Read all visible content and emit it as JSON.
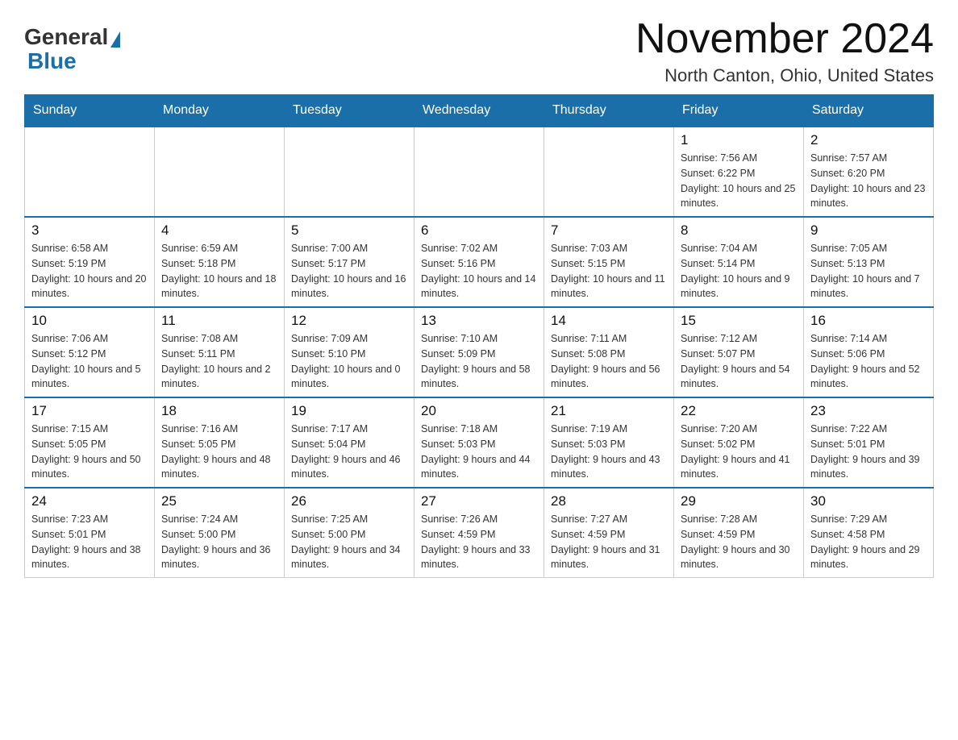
{
  "header": {
    "logo": {
      "general": "General",
      "blue": "Blue"
    },
    "title": "November 2024",
    "location": "North Canton, Ohio, United States"
  },
  "calendar": {
    "days_of_week": [
      "Sunday",
      "Monday",
      "Tuesday",
      "Wednesday",
      "Thursday",
      "Friday",
      "Saturday"
    ],
    "weeks": [
      [
        {
          "day": "",
          "sunrise": "",
          "sunset": "",
          "daylight": ""
        },
        {
          "day": "",
          "sunrise": "",
          "sunset": "",
          "daylight": ""
        },
        {
          "day": "",
          "sunrise": "",
          "sunset": "",
          "daylight": ""
        },
        {
          "day": "",
          "sunrise": "",
          "sunset": "",
          "daylight": ""
        },
        {
          "day": "",
          "sunrise": "",
          "sunset": "",
          "daylight": ""
        },
        {
          "day": "1",
          "sunrise": "Sunrise: 7:56 AM",
          "sunset": "Sunset: 6:22 PM",
          "daylight": "Daylight: 10 hours and 25 minutes."
        },
        {
          "day": "2",
          "sunrise": "Sunrise: 7:57 AM",
          "sunset": "Sunset: 6:20 PM",
          "daylight": "Daylight: 10 hours and 23 minutes."
        }
      ],
      [
        {
          "day": "3",
          "sunrise": "Sunrise: 6:58 AM",
          "sunset": "Sunset: 5:19 PM",
          "daylight": "Daylight: 10 hours and 20 minutes."
        },
        {
          "day": "4",
          "sunrise": "Sunrise: 6:59 AM",
          "sunset": "Sunset: 5:18 PM",
          "daylight": "Daylight: 10 hours and 18 minutes."
        },
        {
          "day": "5",
          "sunrise": "Sunrise: 7:00 AM",
          "sunset": "Sunset: 5:17 PM",
          "daylight": "Daylight: 10 hours and 16 minutes."
        },
        {
          "day": "6",
          "sunrise": "Sunrise: 7:02 AM",
          "sunset": "Sunset: 5:16 PM",
          "daylight": "Daylight: 10 hours and 14 minutes."
        },
        {
          "day": "7",
          "sunrise": "Sunrise: 7:03 AM",
          "sunset": "Sunset: 5:15 PM",
          "daylight": "Daylight: 10 hours and 11 minutes."
        },
        {
          "day": "8",
          "sunrise": "Sunrise: 7:04 AM",
          "sunset": "Sunset: 5:14 PM",
          "daylight": "Daylight: 10 hours and 9 minutes."
        },
        {
          "day": "9",
          "sunrise": "Sunrise: 7:05 AM",
          "sunset": "Sunset: 5:13 PM",
          "daylight": "Daylight: 10 hours and 7 minutes."
        }
      ],
      [
        {
          "day": "10",
          "sunrise": "Sunrise: 7:06 AM",
          "sunset": "Sunset: 5:12 PM",
          "daylight": "Daylight: 10 hours and 5 minutes."
        },
        {
          "day": "11",
          "sunrise": "Sunrise: 7:08 AM",
          "sunset": "Sunset: 5:11 PM",
          "daylight": "Daylight: 10 hours and 2 minutes."
        },
        {
          "day": "12",
          "sunrise": "Sunrise: 7:09 AM",
          "sunset": "Sunset: 5:10 PM",
          "daylight": "Daylight: 10 hours and 0 minutes."
        },
        {
          "day": "13",
          "sunrise": "Sunrise: 7:10 AM",
          "sunset": "Sunset: 5:09 PM",
          "daylight": "Daylight: 9 hours and 58 minutes."
        },
        {
          "day": "14",
          "sunrise": "Sunrise: 7:11 AM",
          "sunset": "Sunset: 5:08 PM",
          "daylight": "Daylight: 9 hours and 56 minutes."
        },
        {
          "day": "15",
          "sunrise": "Sunrise: 7:12 AM",
          "sunset": "Sunset: 5:07 PM",
          "daylight": "Daylight: 9 hours and 54 minutes."
        },
        {
          "day": "16",
          "sunrise": "Sunrise: 7:14 AM",
          "sunset": "Sunset: 5:06 PM",
          "daylight": "Daylight: 9 hours and 52 minutes."
        }
      ],
      [
        {
          "day": "17",
          "sunrise": "Sunrise: 7:15 AM",
          "sunset": "Sunset: 5:05 PM",
          "daylight": "Daylight: 9 hours and 50 minutes."
        },
        {
          "day": "18",
          "sunrise": "Sunrise: 7:16 AM",
          "sunset": "Sunset: 5:05 PM",
          "daylight": "Daylight: 9 hours and 48 minutes."
        },
        {
          "day": "19",
          "sunrise": "Sunrise: 7:17 AM",
          "sunset": "Sunset: 5:04 PM",
          "daylight": "Daylight: 9 hours and 46 minutes."
        },
        {
          "day": "20",
          "sunrise": "Sunrise: 7:18 AM",
          "sunset": "Sunset: 5:03 PM",
          "daylight": "Daylight: 9 hours and 44 minutes."
        },
        {
          "day": "21",
          "sunrise": "Sunrise: 7:19 AM",
          "sunset": "Sunset: 5:03 PM",
          "daylight": "Daylight: 9 hours and 43 minutes."
        },
        {
          "day": "22",
          "sunrise": "Sunrise: 7:20 AM",
          "sunset": "Sunset: 5:02 PM",
          "daylight": "Daylight: 9 hours and 41 minutes."
        },
        {
          "day": "23",
          "sunrise": "Sunrise: 7:22 AM",
          "sunset": "Sunset: 5:01 PM",
          "daylight": "Daylight: 9 hours and 39 minutes."
        }
      ],
      [
        {
          "day": "24",
          "sunrise": "Sunrise: 7:23 AM",
          "sunset": "Sunset: 5:01 PM",
          "daylight": "Daylight: 9 hours and 38 minutes."
        },
        {
          "day": "25",
          "sunrise": "Sunrise: 7:24 AM",
          "sunset": "Sunset: 5:00 PM",
          "daylight": "Daylight: 9 hours and 36 minutes."
        },
        {
          "day": "26",
          "sunrise": "Sunrise: 7:25 AM",
          "sunset": "Sunset: 5:00 PM",
          "daylight": "Daylight: 9 hours and 34 minutes."
        },
        {
          "day": "27",
          "sunrise": "Sunrise: 7:26 AM",
          "sunset": "Sunset: 4:59 PM",
          "daylight": "Daylight: 9 hours and 33 minutes."
        },
        {
          "day": "28",
          "sunrise": "Sunrise: 7:27 AM",
          "sunset": "Sunset: 4:59 PM",
          "daylight": "Daylight: 9 hours and 31 minutes."
        },
        {
          "day": "29",
          "sunrise": "Sunrise: 7:28 AM",
          "sunset": "Sunset: 4:59 PM",
          "daylight": "Daylight: 9 hours and 30 minutes."
        },
        {
          "day": "30",
          "sunrise": "Sunrise: 7:29 AM",
          "sunset": "Sunset: 4:58 PM",
          "daylight": "Daylight: 9 hours and 29 minutes."
        }
      ]
    ]
  }
}
